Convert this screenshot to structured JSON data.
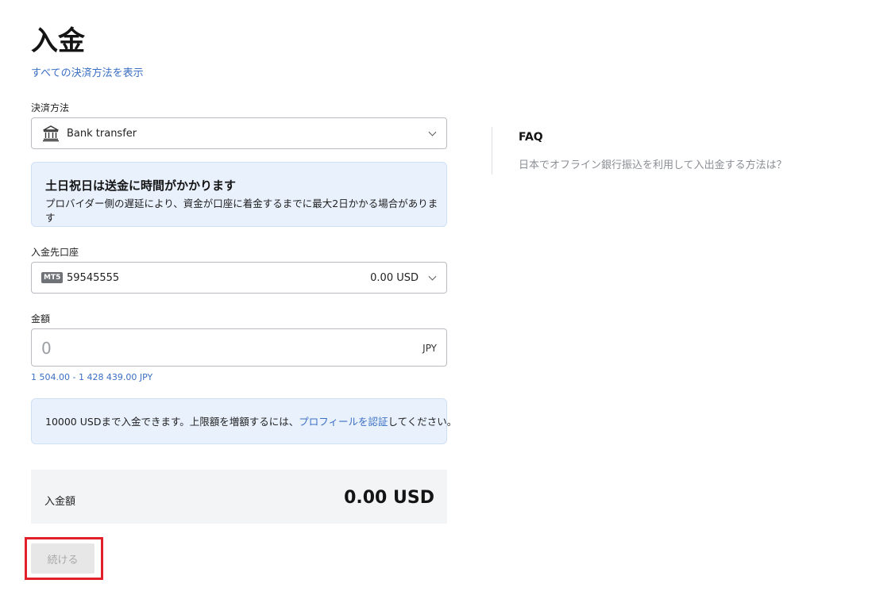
{
  "page": {
    "title": "入金",
    "all_methods_link": "すべての決済方法を表示"
  },
  "payment_method": {
    "label": "決済方法",
    "selected": "Bank transfer",
    "icon": "bank-icon"
  },
  "weekend_notice": {
    "title": "土日祝日は送金に時間がかかります",
    "text": "プロバイダー側の遅延により、資金が口座に着金するまでに最大2日かかる場合があります"
  },
  "account": {
    "label": "入金先口座",
    "badge": "MT5",
    "number": "59545555",
    "balance": "0.00 USD"
  },
  "amount": {
    "label": "金額",
    "placeholder": "0",
    "value": "",
    "currency": "JPY",
    "range": "1 504.00 - 1 428 439.00 JPY"
  },
  "limit_notice": {
    "text_before": "10000 USDまで入金できます。上限額を増額するには、",
    "link": "プロフィールを認証",
    "text_after": "してください。"
  },
  "summary": {
    "label": "入金額",
    "amount": "0.00 USD"
  },
  "continue_button": {
    "label": "続ける",
    "enabled": false
  },
  "faq": {
    "title": "FAQ",
    "questions": [
      "日本でオフライン銀行振込を利用して入出金する方法は？"
    ]
  },
  "colors": {
    "link": "#3a6fc4",
    "banner_bg": "#e9f1fd",
    "highlight": "#e0202a",
    "disabled_bg": "#e7e7e7"
  }
}
